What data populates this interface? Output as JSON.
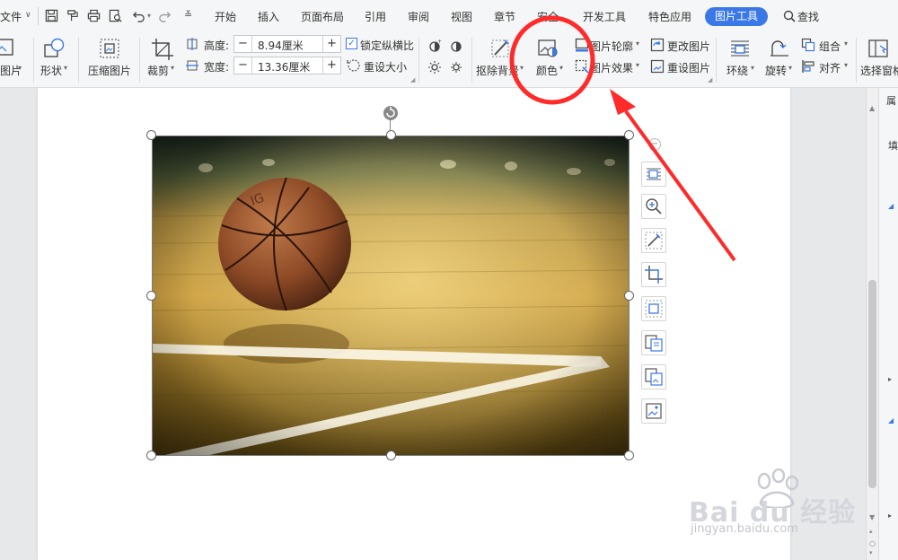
{
  "tabs": {
    "file": "文件",
    "items": [
      "开始",
      "插入",
      "页面布局",
      "引用",
      "审阅",
      "视图",
      "章节",
      "安全",
      "开发工具",
      "特色应用"
    ],
    "active": "图片工具",
    "search": "查找"
  },
  "ribbon": {
    "picture": "图片",
    "shape": "形状",
    "compress": "压缩图片",
    "crop": "裁剪",
    "height_label": "高度:",
    "height_value": "8.94厘米",
    "width_label": "宽度:",
    "width_value": "13.36厘米",
    "lock_ratio": "锁定纵横比",
    "reset_size": "重设大小",
    "remove_bg": "抠除背景",
    "color": "颜色",
    "outline": "图片轮廓",
    "effects": "图片效果",
    "change_picture": "更改图片",
    "reset_picture": "重设图片",
    "wrap": "环绕",
    "rotate": "旋转",
    "group": "组合",
    "align": "对齐",
    "selection_pane": "选择窗格",
    "minus": "−",
    "plus": "+"
  },
  "right_panel": {
    "ch1": "属",
    "ch2": "填"
  },
  "watermark": {
    "brand": "Bai du 经验",
    "url": "jingyan.baidu.com"
  },
  "annotation": {
    "circle_color": "#ff2a2a",
    "arrow_color": "#ff2a2a"
  },
  "colors": {
    "accent": "#3b78e7"
  }
}
